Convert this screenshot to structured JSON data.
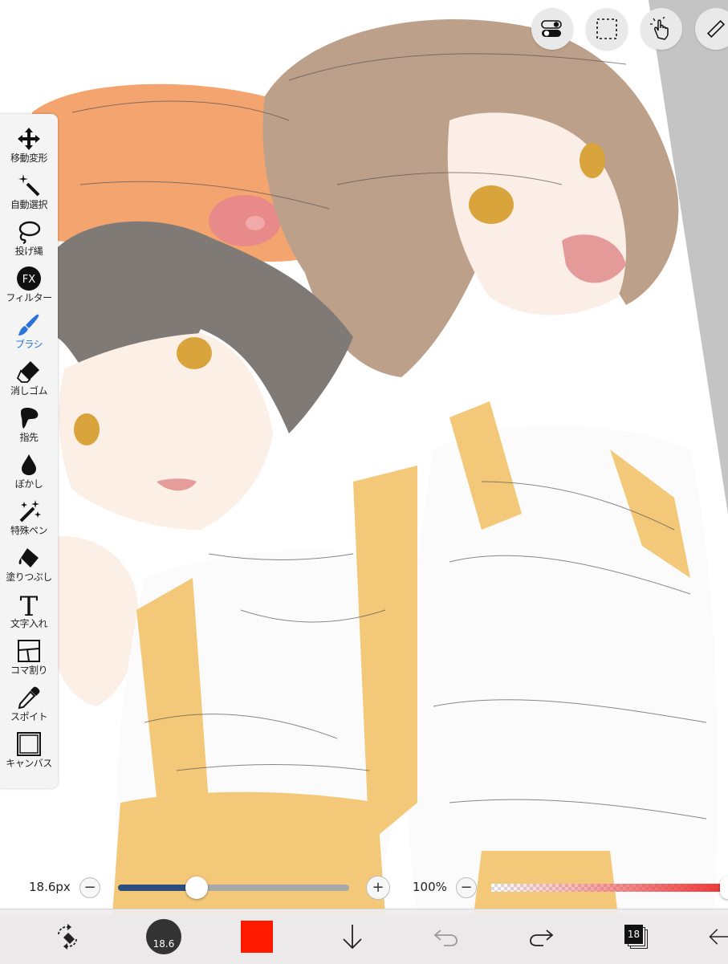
{
  "toolbar": {
    "items": [
      {
        "label": "移動変形",
        "icon": "move-icon"
      },
      {
        "label": "自動選択",
        "icon": "magic-wand-icon"
      },
      {
        "label": "投げ縄",
        "icon": "lasso-icon"
      },
      {
        "label": "フィルター",
        "icon": "fx-icon"
      },
      {
        "label": "ブラシ",
        "icon": "brush-icon",
        "active": true
      },
      {
        "label": "消しゴム",
        "icon": "eraser-icon"
      },
      {
        "label": "指先",
        "icon": "smudge-icon"
      },
      {
        "label": "ぼかし",
        "icon": "blur-drop-icon"
      },
      {
        "label": "特殊ペン",
        "icon": "special-pen-icon"
      },
      {
        "label": "塗りつぶし",
        "icon": "fill-bucket-icon"
      },
      {
        "label": "文字入れ",
        "icon": "text-icon"
      },
      {
        "label": "コマ割り",
        "icon": "panel-icon"
      },
      {
        "label": "スポイト",
        "icon": "eyedropper-icon"
      },
      {
        "label": "キャンバス",
        "icon": "canvas-icon"
      }
    ],
    "fx_glyph": "FX",
    "text_glyph": "T"
  },
  "brush": {
    "size_label": "18.6px",
    "size_fraction": 0.34,
    "minus": "−",
    "plus": "+"
  },
  "opacity": {
    "label": "100%",
    "value_fraction": 1.0,
    "minus": "−"
  },
  "bottom": {
    "brush_size_badge": "18.6",
    "layer_count": "18"
  },
  "colors": {
    "accent": "#2a73d9",
    "current_color": "#ff1a00",
    "size_slider_fill": "#2b4e7e",
    "opacity_slider_fill": "#ee3333"
  }
}
